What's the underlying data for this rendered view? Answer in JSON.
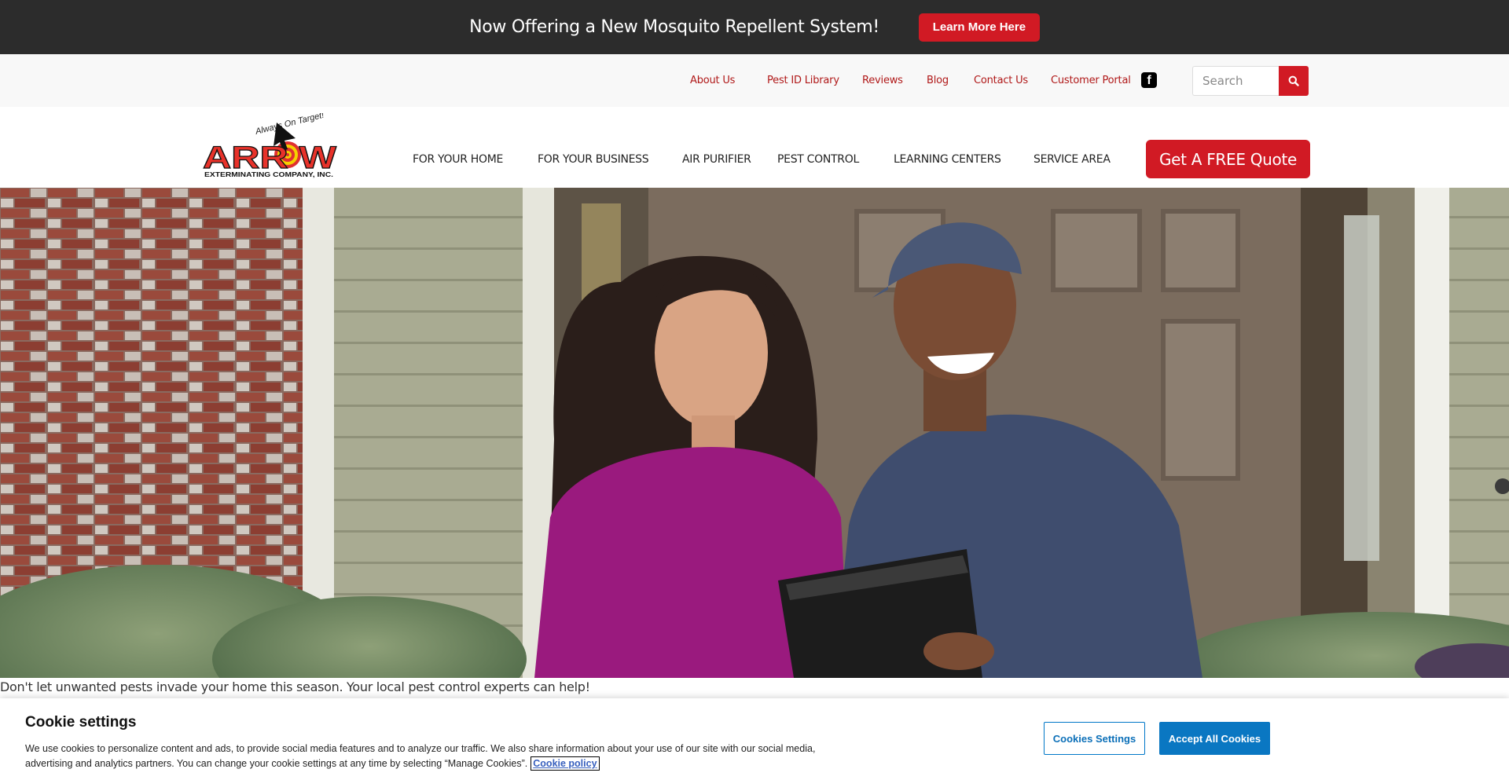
{
  "promo": {
    "text": "Now Offering a New Mosquito Repellent System!",
    "button_label": "Learn More Here"
  },
  "utility_nav": {
    "links": [
      "About Us",
      "Pest ID Library",
      "Reviews",
      "Blog",
      "Contact Us",
      "Customer Portal"
    ],
    "social_icon": "facebook-icon",
    "social_glyph": "f",
    "search_placeholder": "Search",
    "search_value": ""
  },
  "logo": {
    "brand": "ARROW",
    "tagline": "Always On Target!",
    "subtitle": "EXTERMINATING COMPANY, INC."
  },
  "main_nav": {
    "items": [
      "FOR YOUR HOME",
      "FOR YOUR BUSINESS",
      "AIR PURIFIER",
      "PEST CONTROL",
      "LEARNING CENTERS",
      "SERVICE AREA"
    ],
    "cta_label": "Get A FREE Quote"
  },
  "hero": {
    "image_description": "Pest control technician showing a tablet to a smiling homeowner on a front porch",
    "caption": "Don't let unwanted pests invade your home this season. Your local pest control experts can help!"
  },
  "cookie_banner": {
    "title": "Cookie settings",
    "text": "We use cookies to personalize content and ads, to provide social media features and to analyze our traffic. We also share information about your use of our site with our social media, advertising and analytics partners. You can change your cookie settings at any time by selecting “Manage Cookies”.",
    "policy_link": "Cookie policy",
    "settings_button": "Cookies Settings",
    "accept_button": "Accept All Cookies"
  },
  "colors": {
    "brand_red": "#d11a24",
    "promo_bg": "#2c2c2c",
    "utility_link": "#b01818",
    "cookie_blue": "#0a77c2"
  }
}
